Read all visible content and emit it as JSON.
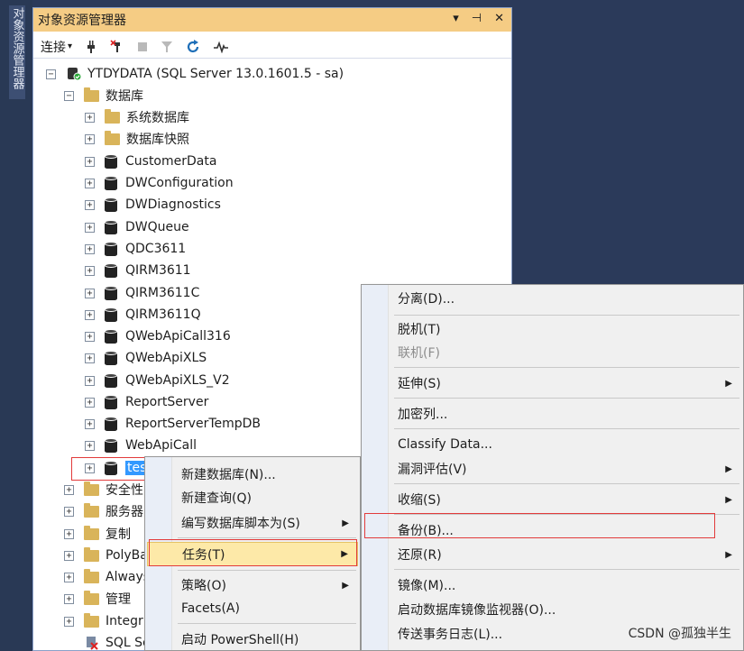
{
  "side_tab": {
    "label": "对象资源管理器"
  },
  "panel": {
    "title": "对象资源管理器",
    "title_buttons": [
      "▾",
      "⊣",
      "✕"
    ]
  },
  "toolbar": {
    "connect_label": "连接",
    "connect_arrow": "▾"
  },
  "tree": {
    "server": "YTDYDATA (SQL Server 13.0.1601.5 - sa)",
    "databases_folder": "数据库",
    "system_dbs": "系统数据库",
    "snapshots": "数据库快照",
    "databases": [
      "CustomerData",
      "DWConfiguration",
      "DWDiagnostics",
      "DWQueue",
      "QDC3611",
      "QIRM3611",
      "QIRM3611C",
      "QIRM3611Q",
      "QWebApiCall316",
      "QWebApiXLS",
      "QWebApiXLS_V2",
      "ReportServer",
      "ReportServerTempDB",
      "WebApiCall",
      "tes"
    ],
    "folders": [
      "安全性",
      "服务器",
      "复制",
      "PolyBa",
      "Always",
      "管理",
      "Integr"
    ],
    "bottom_item": "SQL Se"
  },
  "menu1": {
    "items": [
      {
        "label": "新建数据库(N)...",
        "arrow": ""
      },
      {
        "label": "新建查询(Q)",
        "arrow": ""
      },
      {
        "label": "编写数据库脚本为(S)",
        "arrow": "▶"
      },
      {
        "label": "任务(T)",
        "arrow": "▶"
      },
      {
        "label": "策略(O)",
        "arrow": "▶"
      },
      {
        "label": "Facets(A)",
        "arrow": ""
      },
      {
        "label": "启动 PowerShell(H)",
        "arrow": ""
      }
    ]
  },
  "menu2": {
    "items": [
      {
        "label": "分离(D)...",
        "arrow": ""
      },
      {
        "label": "脱机(T)",
        "arrow": ""
      },
      {
        "label": "联机(F)",
        "arrow": ""
      },
      {
        "label": "延伸(S)",
        "arrow": "▶"
      },
      {
        "label": "加密列...",
        "arrow": ""
      },
      {
        "label": "Classify Data...",
        "arrow": ""
      },
      {
        "label": "漏洞评估(V)",
        "arrow": "▶"
      },
      {
        "label": "收缩(S)",
        "arrow": "▶"
      },
      {
        "label": "备份(B)...",
        "arrow": ""
      },
      {
        "label": "还原(R)",
        "arrow": "▶"
      },
      {
        "label": "镜像(M)...",
        "arrow": ""
      },
      {
        "label": "启动数据库镜像监视器(O)...",
        "arrow": ""
      },
      {
        "label": "传送事务日志(L)...",
        "arrow": ""
      }
    ]
  },
  "watermark": "CSDN @孤独半生",
  "colors": {
    "title_bg": "#f5cc84",
    "selection": "#3399ff",
    "menu_highlight": "#fde9a8",
    "annotation_red": "#e23b3b"
  }
}
